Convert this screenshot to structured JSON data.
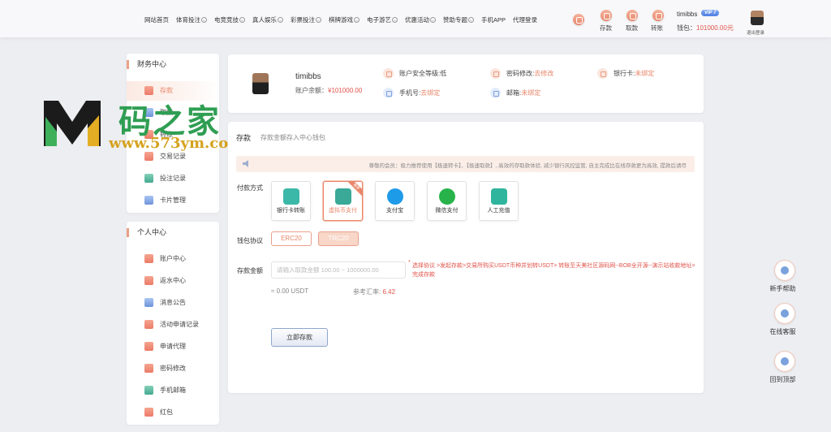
{
  "header": {
    "nav": [
      {
        "label": "网站首页",
        "dropdown": false
      },
      {
        "label": "体育投注",
        "dropdown": true
      },
      {
        "label": "电竞竞技",
        "dropdown": true
      },
      {
        "label": "真人娱乐",
        "dropdown": true
      },
      {
        "label": "彩票投注",
        "dropdown": true
      },
      {
        "label": "棋牌游戏",
        "dropdown": true
      },
      {
        "label": "电子游艺",
        "dropdown": true
      },
      {
        "label": "优惠活动",
        "dropdown": true
      },
      {
        "label": "赞助专题",
        "dropdown": true
      },
      {
        "label": "手机APP",
        "dropdown": false
      },
      {
        "label": "代理登录",
        "dropdown": false
      }
    ],
    "quick": {
      "deposit": "存款",
      "withdraw": "取款",
      "transfer": "转账"
    },
    "user": {
      "name": "timibbs",
      "vip": "VIP 7",
      "wallet_label": "钱包：",
      "wallet_amount": "101000.00元",
      "logout": "退出登录"
    }
  },
  "finance": {
    "title": "财务中心",
    "items": [
      "存款",
      "取款",
      "转账",
      "交易记录",
      "投注记录",
      "卡片管理"
    ]
  },
  "personal": {
    "title": "个人中心",
    "items": [
      "账户中心",
      "返水中心",
      "消息公告",
      "活动申请记录",
      "申请代理",
      "密码修改",
      "手机邮箱",
      "红包"
    ]
  },
  "watermark": {
    "title": "码之家",
    "url": "www.573ym.com"
  },
  "account": {
    "name": "timibbs",
    "balance_label": "账户余额：",
    "balance": "¥101000.00",
    "security_label": "账户安全等级: ",
    "security_value": "低",
    "password_label": "密码修改: ",
    "password_value": "去修改",
    "card_label": "银行卡: ",
    "card_value": "未绑定",
    "phone_label": "手机号: ",
    "phone_value": "去绑定",
    "email_label": "邮箱: ",
    "email_value": "未绑定"
  },
  "deposit": {
    "tab": "存款",
    "tab_desc": "存款金额存入中心钱包",
    "notice": "尊敬的会员：极力推荐使用【极速转卡】、【极速取款】, 高效的存取款体验, 减少银行风控监管, 自主完成比在线存款更为高效, 提款后请尽",
    "method_label": "付款方式",
    "methods": [
      {
        "label": "银行卡转账",
        "color": "#3bb8a8",
        "selected": false
      },
      {
        "label": "虚拟币支付",
        "color": "#3aa997",
        "selected": true,
        "badge": "推荐"
      },
      {
        "label": "支付宝",
        "color": "#1e9be8",
        "selected": false
      },
      {
        "label": "微信支付",
        "color": "#27b34a",
        "selected": false
      },
      {
        "label": "人工充值",
        "color": "#2fb59d",
        "selected": false
      }
    ],
    "protocol_label": "钱包协议",
    "protocols": [
      {
        "label": "ERC20",
        "active": false
      },
      {
        "label": "TRC20",
        "active": true
      }
    ],
    "amount_label": "存款金额",
    "amount_placeholder": "请输入取款金额 100.00 ~ 1000000.00",
    "hint": "选择协议 >发起存款>交易所购买USDT币种并划转USDT> 转账至天美社区源码网--BOB全开源--演示站收款地址>完成存款",
    "usdt": "≈ 0.00 USDT",
    "rate_label": "参考汇率: ",
    "rate_value": "6.42",
    "submit": "立即存款"
  },
  "floating": {
    "help": "新手帮助",
    "service": "在线客服",
    "top": "回到顶部"
  },
  "colors": {
    "accent": "#e8866a",
    "danger": "#e0534a",
    "background": "#edeef2"
  }
}
